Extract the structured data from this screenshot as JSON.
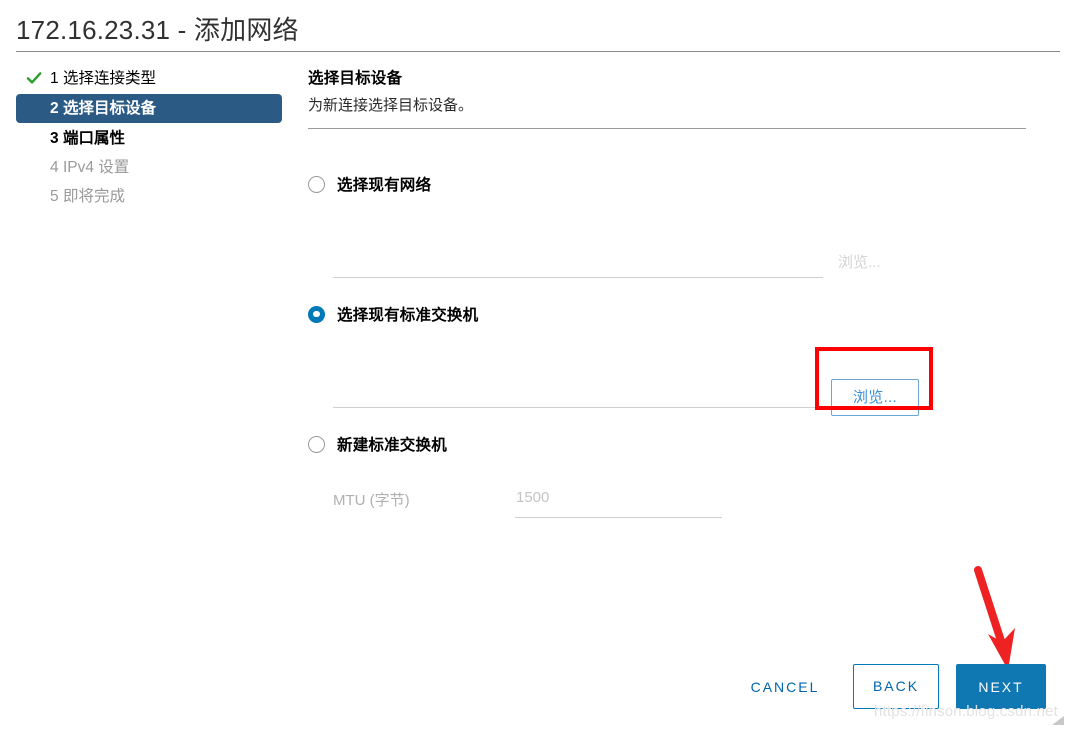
{
  "window": {
    "title": "172.16.23.31 - 添加网络"
  },
  "steps": [
    {
      "number": "1",
      "label": "选择连接类型",
      "state": "done",
      "icon": "check-icon"
    },
    {
      "number": "2",
      "label": "选择目标设备",
      "state": "active"
    },
    {
      "number": "3",
      "label": "端口属性",
      "state": "next"
    },
    {
      "number": "4",
      "label": "IPv4 设置",
      "state": "pending"
    },
    {
      "number": "5",
      "label": "即将完成",
      "state": "pending"
    }
  ],
  "content": {
    "title": "选择目标设备",
    "subtitle": "为新连接选择目标设备。"
  },
  "options": [
    {
      "label": "选择现有网络",
      "selected": false,
      "browse_label": "浏览...",
      "browse_enabled": false
    },
    {
      "label": "选择现有标准交换机",
      "selected": true,
      "browse_label": "浏览...",
      "browse_enabled": true,
      "highlighted": true
    },
    {
      "label": "新建标准交换机",
      "selected": false,
      "mtu_label": "MTU (字节)",
      "mtu_value": "1500"
    }
  ],
  "footer": {
    "cancel_label": "CANCEL",
    "back_label": "BACK",
    "next_label": "NEXT"
  },
  "annotations": {
    "arrow_target": "next-button",
    "box_target": "browse-button"
  },
  "watermark": {
    "text": "https://finson.blog.csdn.net"
  },
  "colors": {
    "accent": "#0079b8",
    "active_step_bg": "#2b5a85",
    "primary_button": "#0f77b1",
    "link": "#0065ab",
    "success": "#2b9f2b",
    "annotation": "#ff0000",
    "disabled_text": "#c4c4c4"
  }
}
